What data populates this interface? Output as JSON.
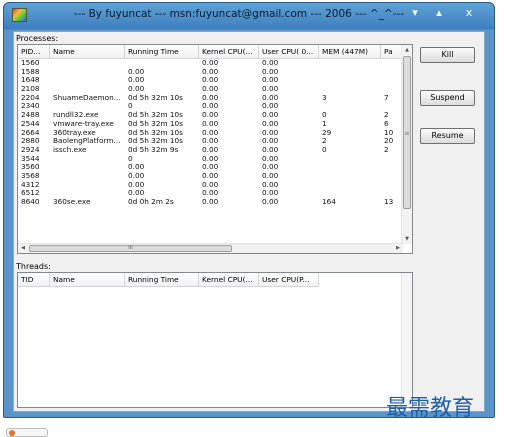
{
  "window": {
    "title": "--- By fuyuncat --- msn:fuyuncat@gmail.com --- 2006 --- ^_^---",
    "minimize_glyph": "▾",
    "maximize_glyph": "▴",
    "close_glyph": "x"
  },
  "processes": {
    "label": "Processes:",
    "columns": [
      "PID...",
      "Name",
      "Running Time",
      "Kernel CPU(...",
      "User CPU( 0...",
      "MEM (447M)",
      "Pa"
    ],
    "rows": [
      [
        "1560",
        "",
        "",
        "0.00",
        "0.00",
        "",
        ""
      ],
      [
        "1588",
        "",
        "0.00",
        "0.00",
        "0.00",
        "",
        ""
      ],
      [
        "1648",
        "",
        "0.00",
        "0.00",
        "0.00",
        "",
        ""
      ],
      [
        "2108",
        "",
        "0.00",
        "0.00",
        "0.00",
        "",
        ""
      ],
      [
        "2204",
        "ShuameDaemon...",
        "0d 5h 32m 10s",
        "0.00",
        "0.00",
        "3",
        "7"
      ],
      [
        "2340",
        "",
        "0",
        "0.00",
        "0.00",
        "",
        ""
      ],
      [
        "2488",
        "rundll32.exe",
        "0d 5h 32m 10s",
        "0.00",
        "0.00",
        "0",
        "2"
      ],
      [
        "2544",
        "vmware-tray.exe",
        "0d 5h 32m 10s",
        "0.00",
        "0.00",
        "1",
        "6"
      ],
      [
        "2664",
        "360tray.exe",
        "0d 5h 32m 10s",
        "0.00",
        "0.00",
        "29",
        "10"
      ],
      [
        "2880",
        "BaolengPlatform...",
        "0d 5h 32m 10s",
        "0.00",
        "0.00",
        "2",
        "20"
      ],
      [
        "2924",
        "issch.exe",
        "0d 5h 32m 9s",
        "0.00",
        "0.00",
        "0",
        "2"
      ],
      [
        "3544",
        "",
        "0",
        "0.00",
        "0.00",
        "",
        ""
      ],
      [
        "3560",
        "",
        "0.00",
        "0.00",
        "0.00",
        "",
        ""
      ],
      [
        "3568",
        "",
        "0.00",
        "0.00",
        "0.00",
        "",
        ""
      ],
      [
        "4312",
        "",
        "0.00",
        "0.00",
        "0.00",
        "",
        ""
      ],
      [
        "6512",
        "",
        "0.00",
        "0.00",
        "0.00",
        "",
        ""
      ],
      [
        "8640",
        "360se.exe",
        "0d 0h 2m 2s",
        "0.00",
        "0.00",
        "164",
        "13"
      ]
    ],
    "scroll_thumb_glyph": "≡",
    "hscroll_thumb_glyph": "III"
  },
  "threads": {
    "label": "Threads:",
    "columns": [
      "TID",
      "Name",
      "Running Time",
      "Kernel CPU(...",
      "User CPU(P..."
    ]
  },
  "buttons": {
    "kill": "Kill",
    "suspend": "Suspend",
    "resume": "Resume"
  },
  "watermark": "最需教育",
  "icons": [
    "app-icon",
    "minimize-icon",
    "maximize-icon",
    "close-icon",
    "scroll-up-icon",
    "scroll-down-icon",
    "scroll-left-icon",
    "scroll-right-icon"
  ]
}
